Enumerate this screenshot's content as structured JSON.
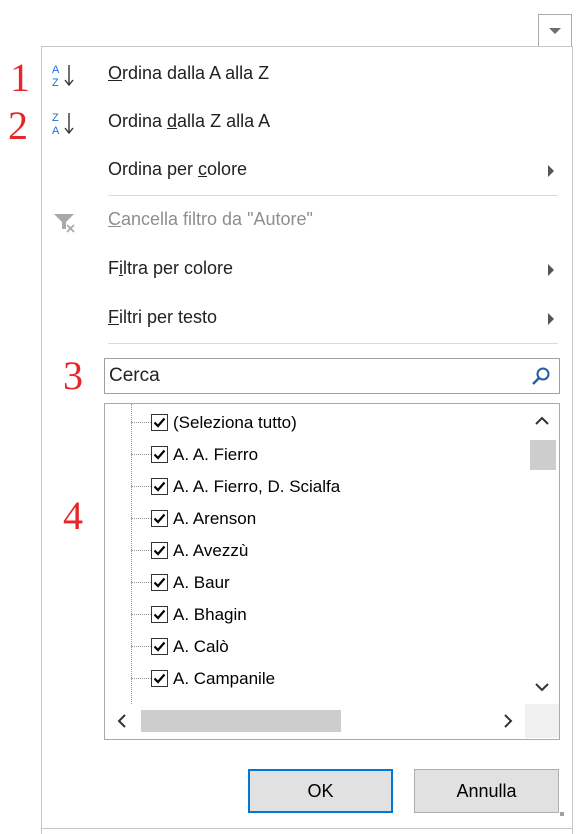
{
  "numbers": [
    "1",
    "2",
    "3",
    "4"
  ],
  "menu": {
    "sort_asc": {
      "before": "",
      "mnemonic": "O",
      "after": "rdina dalla A alla Z"
    },
    "sort_desc": {
      "before": "Ordina ",
      "mnemonic": "d",
      "after": "alla Z alla A"
    },
    "sort_color": {
      "before": "Ordina per ",
      "mnemonic": "c",
      "after": "olore"
    },
    "clear_filter": {
      "before": "",
      "mnemonic": "C",
      "after": "ancella filtro da \"Autore\""
    },
    "filter_color": {
      "before": "F",
      "mnemonic": "i",
      "after": "ltra per colore"
    },
    "text_filters": {
      "before": "",
      "mnemonic": "F",
      "after": "iltri per testo"
    }
  },
  "search": {
    "value": "",
    "placeholder": "Cerca"
  },
  "list": {
    "items": [
      {
        "label": "(Seleziona tutto)",
        "checked": true
      },
      {
        "label": "A. A. Fierro",
        "checked": true
      },
      {
        "label": "A. A. Fierro, D. Scialfa",
        "checked": true
      },
      {
        "label": "A. Arenson",
        "checked": true
      },
      {
        "label": "A. Avezzù",
        "checked": true
      },
      {
        "label": "A. Baur",
        "checked": true
      },
      {
        "label": "A. Bhagin",
        "checked": true
      },
      {
        "label": "A. Calò",
        "checked": true
      },
      {
        "label": "A. Campanile",
        "checked": true
      }
    ]
  },
  "buttons": {
    "ok": "OK",
    "cancel": "Annulla"
  },
  "colors": {
    "accent": "#0078d7",
    "number_color": "#e8262a",
    "sort_icon_blue": "#1e6fcf"
  }
}
